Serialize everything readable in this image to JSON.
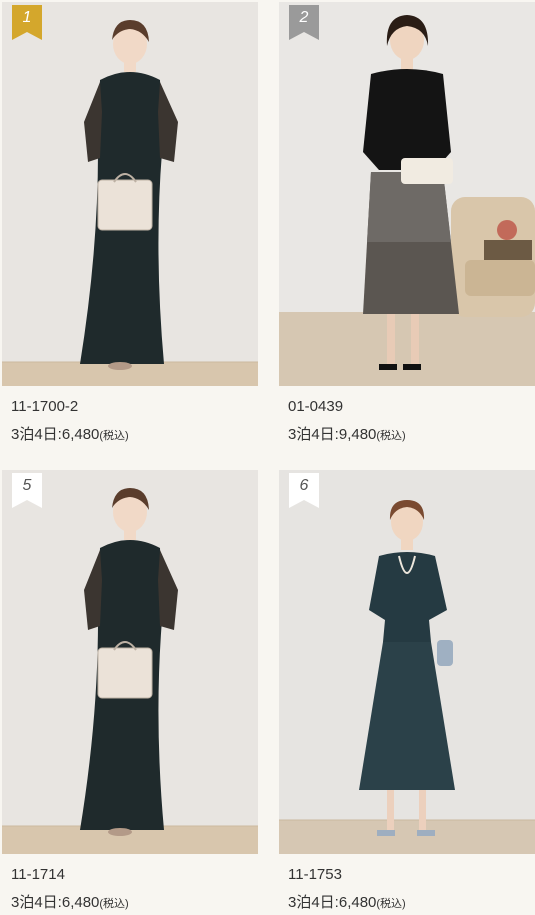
{
  "products": [
    {
      "rank": "1",
      "code": "11-1700-2",
      "price": "3泊4日:6,480",
      "tax": "(税込)",
      "badge_color": "#d4a72c"
    },
    {
      "rank": "2",
      "code": "01-0439",
      "price": "3泊4日:9,480",
      "tax": "(税込)",
      "badge_color": "#9a9a9a"
    },
    {
      "rank": "5",
      "code": "11-1714",
      "price": "3泊4日:6,480",
      "tax": "(税込)",
      "badge_color": "#ffffff"
    },
    {
      "rank": "6",
      "code": "11-1753",
      "price": "3泊4日:6,480",
      "tax": "(税込)",
      "badge_color": "#ffffff"
    }
  ],
  "icons": {
    "rank_badge": "ribbon-bookmark",
    "product_image": "dress-photo"
  }
}
